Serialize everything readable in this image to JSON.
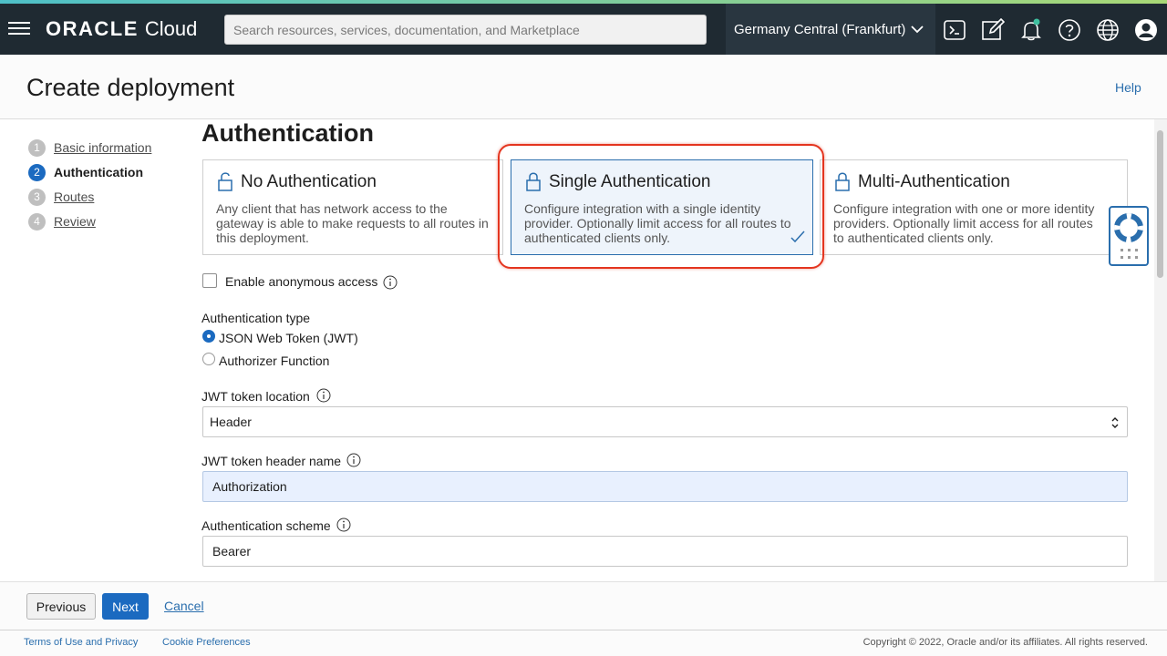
{
  "topbar": {
    "brand": "ORACLE",
    "product": "Cloud",
    "search_placeholder": "Search resources, services, documentation, and Marketplace",
    "region": "Germany Central (Frankfurt)",
    "icons": [
      "menu-icon",
      "cloud-shell-icon",
      "edit-icon",
      "bell-icon",
      "help-icon",
      "globe-icon",
      "user-icon"
    ],
    "accent": "#1b6ac0"
  },
  "header": {
    "title": "Create deployment",
    "help": "Help"
  },
  "steps": [
    {
      "num": "1",
      "label": "Basic information"
    },
    {
      "num": "2",
      "label": "Authentication"
    },
    {
      "num": "3",
      "label": "Routes"
    },
    {
      "num": "4",
      "label": "Review"
    }
  ],
  "section": {
    "title": "Authentication"
  },
  "auth_cards": [
    {
      "title": "No Authentication",
      "description": "Any client that has network access to the gateway is able to make requests to all routes in this deployment.",
      "selected": false
    },
    {
      "title": "Single Authentication",
      "description": "Configure integration with a single identity provider. Optionally limit access for all routes to authenticated clients only.",
      "selected": true
    },
    {
      "title": "Multi-Authentication",
      "description": "Configure integration with one or more identity providers. Optionally limit access for all routes to authenticated clients only.",
      "selected": false
    }
  ],
  "form": {
    "anonymous_label": "Enable anonymous access",
    "auth_type_label": "Authentication type",
    "auth_type_options": [
      "JSON Web Token (JWT)",
      "Authorizer Function"
    ],
    "auth_type_selected": "JSON Web Token (JWT)",
    "token_location_label": "JWT token location",
    "token_location_value": "Header",
    "header_name_label": "JWT token header name",
    "header_name_value": "Authorization",
    "scheme_label": "Authentication scheme",
    "scheme_value": "Bearer"
  },
  "buttons": {
    "previous": "Previous",
    "next": "Next",
    "cancel": "Cancel"
  },
  "footer": {
    "terms": "Terms of Use and Privacy",
    "cookies": "Cookie Preferences",
    "copyright": "Copyright © 2022, Oracle and/or its affiliates. All rights reserved."
  }
}
